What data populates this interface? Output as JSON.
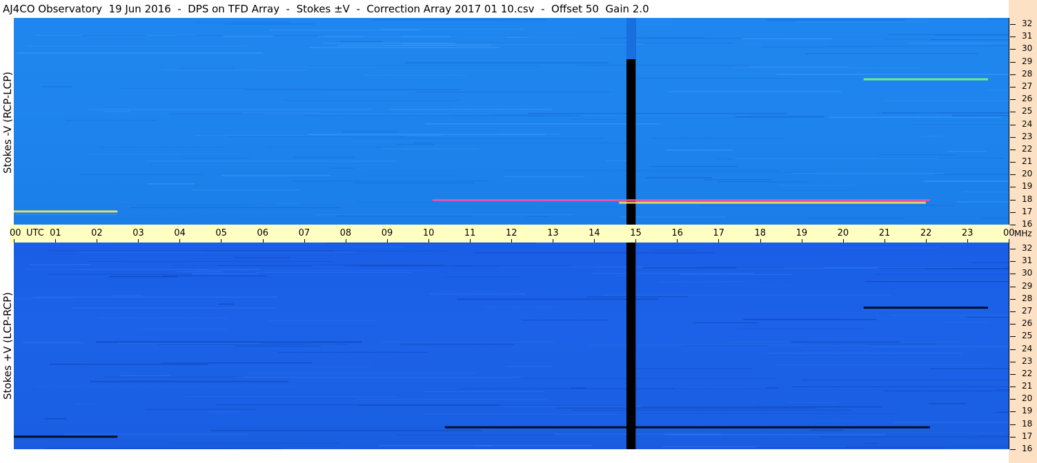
{
  "title": "AJ4CO Observatory  19 Jun 2016  -  DPS on TFD Array  -  Stokes ±V  -  Correction Array 2017 01 10.csv  -  Offset 50  Gain 2.0",
  "chart_data": [
    {
      "type": "heatmap",
      "panel": "top",
      "ylabel": "Stokes -V (RCP-LCP)",
      "x_unit": "UTC",
      "y_unit": "MHz",
      "xlim": [
        0,
        24
      ],
      "ylim": [
        16,
        32.5
      ],
      "x_ticks": [
        "00",
        "01",
        "02",
        "03",
        "04",
        "05",
        "06",
        "07",
        "08",
        "09",
        "10",
        "11",
        "12",
        "13",
        "14",
        "15",
        "16",
        "17",
        "18",
        "19",
        "20",
        "21",
        "22",
        "23",
        "00"
      ],
      "y_ticks": [
        16,
        17,
        18,
        19,
        20,
        21,
        22,
        23,
        24,
        25,
        26,
        27,
        28,
        29,
        30,
        31,
        32
      ],
      "background_color": "#1f86ef",
      "features": [
        {
          "kind": "gap",
          "x_start": 14.78,
          "x_end": 15.0,
          "color": "#000000"
        },
        {
          "kind": "band",
          "x_start": 10.1,
          "x_end": 22.1,
          "y": 17.95,
          "color": "#ff4fa0"
        },
        {
          "kind": "band",
          "x_start": 14.6,
          "x_end": 22.0,
          "y": 17.75,
          "color": "#ffe060"
        },
        {
          "kind": "band",
          "x_start": 0.0,
          "x_end": 2.5,
          "y": 17.05,
          "color": "#ffef5a"
        },
        {
          "kind": "band",
          "x_start": 20.5,
          "x_end": 23.5,
          "y": 27.6,
          "color": "#7bff7b"
        }
      ]
    },
    {
      "type": "heatmap",
      "panel": "bottom",
      "ylabel": "Stokes +V (LCP-RCP)",
      "x_unit": "UTC",
      "y_unit": "MHz",
      "xlim": [
        0,
        24
      ],
      "ylim": [
        16,
        32.5
      ],
      "x_ticks": [
        "00",
        "01",
        "02",
        "03",
        "04",
        "05",
        "06",
        "07",
        "08",
        "09",
        "10",
        "11",
        "12",
        "13",
        "14",
        "15",
        "16",
        "17",
        "18",
        "19",
        "20",
        "21",
        "22",
        "23",
        "00"
      ],
      "y_ticks": [
        16,
        17,
        18,
        19,
        20,
        21,
        22,
        23,
        24,
        25,
        26,
        27,
        28,
        29,
        30,
        31,
        32
      ],
      "background_color": "#1a5ee6",
      "features": [
        {
          "kind": "gap",
          "x_start": 14.78,
          "x_end": 15.0,
          "color": "#000000"
        },
        {
          "kind": "band",
          "x_start": 10.4,
          "x_end": 22.1,
          "y": 17.75,
          "color": "#000000"
        },
        {
          "kind": "band",
          "x_start": 0.0,
          "x_end": 2.5,
          "y": 17.0,
          "color": "#000000"
        },
        {
          "kind": "band",
          "x_start": 20.5,
          "x_end": 23.5,
          "y": 27.3,
          "color": "#000000"
        }
      ]
    }
  ]
}
